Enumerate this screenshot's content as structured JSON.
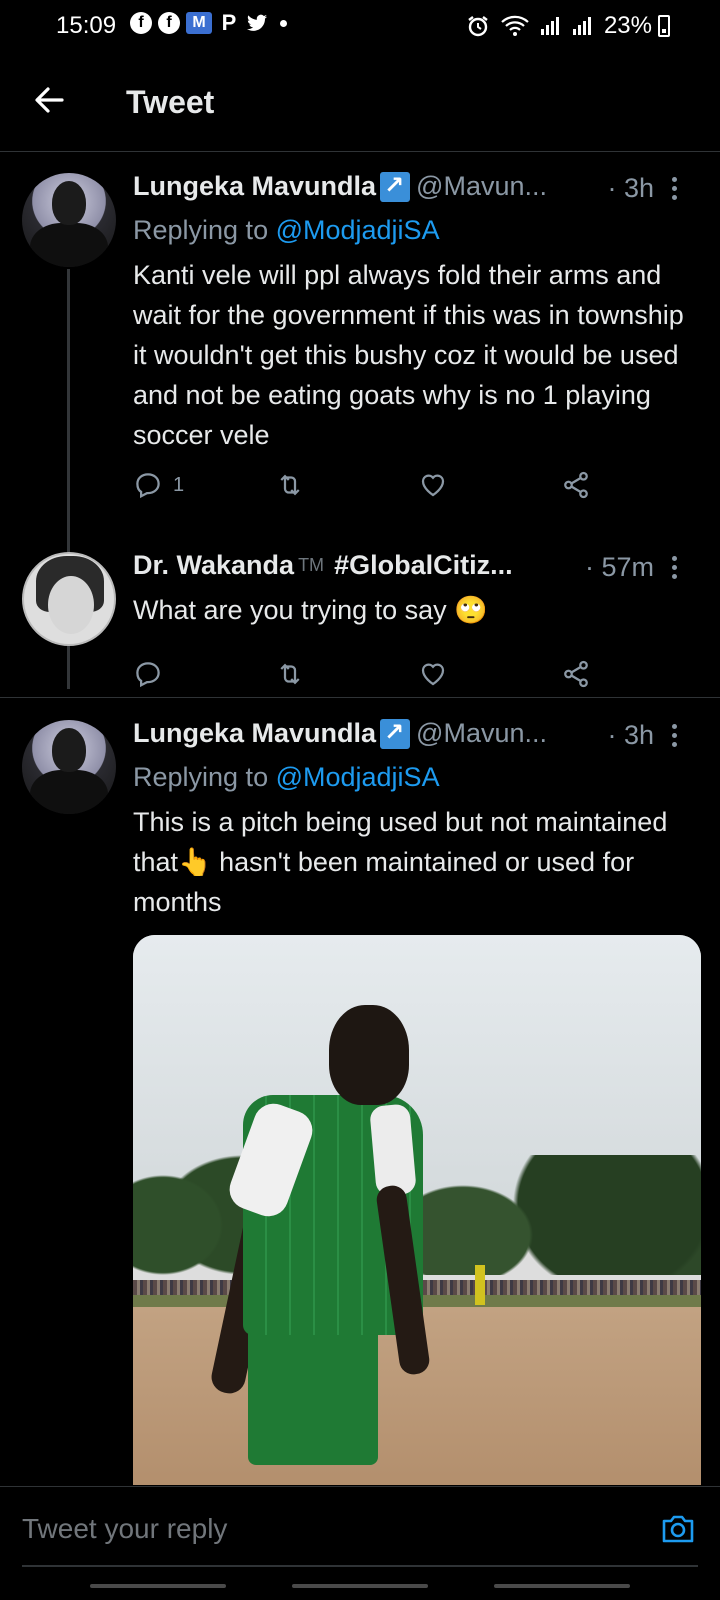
{
  "status_bar": {
    "time": "15:09",
    "apps": [
      "f",
      "f",
      "M",
      "P"
    ],
    "battery": "23%"
  },
  "header": {
    "title": "Tweet"
  },
  "tweets": [
    {
      "name": "Lungeka Mavundla",
      "handle": "@Mavun...",
      "time": "· 3h",
      "replying_label": "Replying to ",
      "replying_to": "@ModjadjiSA",
      "text": "Kanti vele will ppl always fold their arms and wait for the government if this was in township it wouldn't get this bushy coz it would be used and not be eating goats why is no 1 playing soccer vele",
      "reply_count": "1"
    },
    {
      "name": "Dr. Wakanda",
      "tm": "TM",
      "handle": "#GlobalCitiz...",
      "time": "· 57m",
      "text": "What are you trying to say 🙄"
    },
    {
      "name": "Lungeka Mavundla",
      "handle": "@Mavun...",
      "time": "· 3h",
      "replying_label": "Replying to ",
      "replying_to": "@ModjadjiSA",
      "text": "This is a pitch being used but not maintained that👆 hasn't been maintained or used for months"
    }
  ],
  "reply_bar": {
    "placeholder": "Tweet your reply"
  },
  "colors": {
    "background": "#000000",
    "link": "#1d9bf0",
    "secondary_text": "#8b98a5",
    "primary_text": "#e7e9ea"
  },
  "icons": [
    "back-arrow-icon",
    "verified-arrow-icon",
    "more-vertical-icon",
    "reply-icon",
    "retweet-icon",
    "like-icon",
    "share-icon",
    "camera-icon"
  ]
}
